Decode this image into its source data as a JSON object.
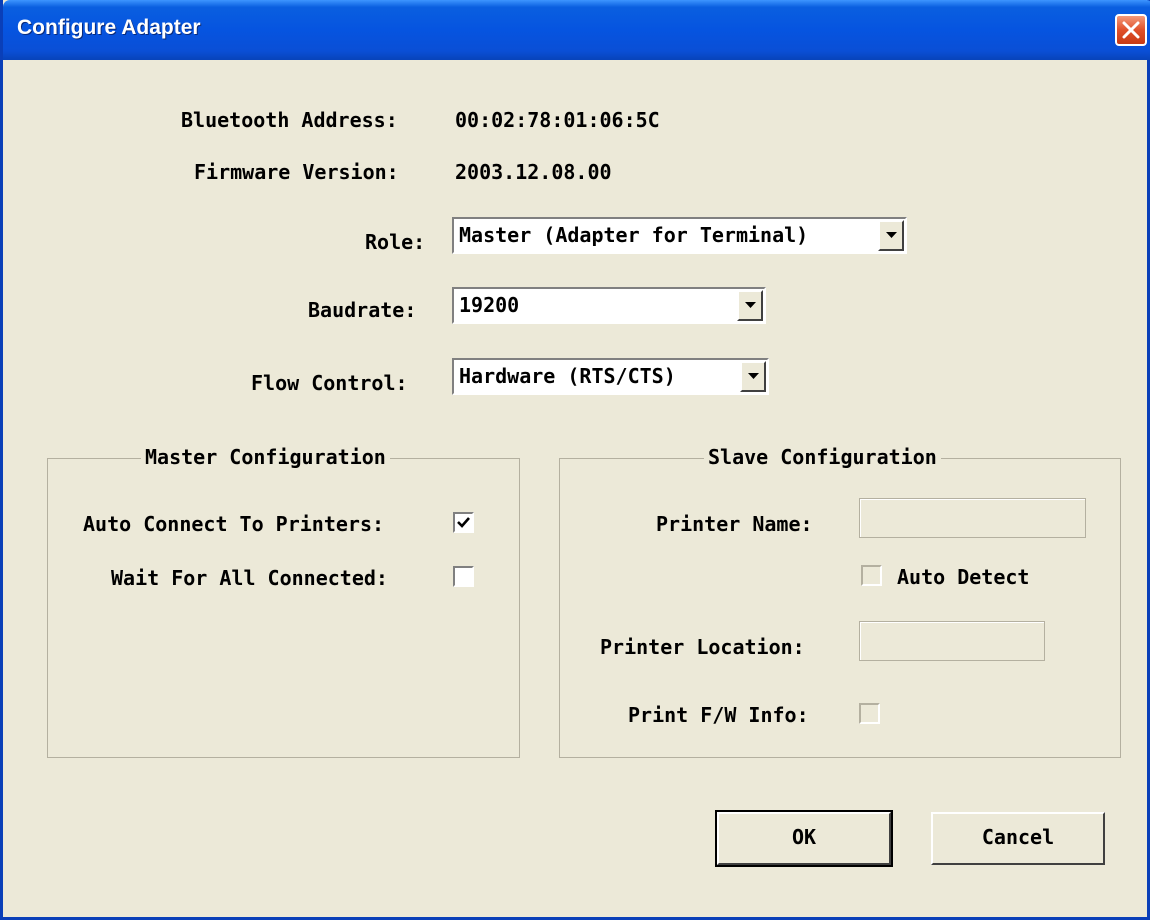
{
  "window": {
    "title": "Configure Adapter"
  },
  "info": {
    "bt_label": "Bluetooth Address:",
    "bt_value": "00:02:78:01:06:5C",
    "fw_label": "Firmware Version:",
    "fw_value": "2003.12.08.00"
  },
  "role": {
    "label": "Role:",
    "value": "Master (Adapter for Terminal)"
  },
  "baudrate": {
    "label": "Baudrate:",
    "value": "19200"
  },
  "flow": {
    "label": "Flow Control:",
    "value": "Hardware (RTS/CTS)"
  },
  "master": {
    "title": "Master Configuration",
    "auto_connect_label": "Auto Connect To Printers:",
    "auto_connect_checked": true,
    "wait_label": "Wait For All Connected:",
    "wait_checked": false
  },
  "slave": {
    "title": "Slave Configuration",
    "printer_name_label": "Printer Name:",
    "printer_name_value": "",
    "auto_detect_label": "Auto Detect",
    "auto_detect_checked": false,
    "printer_location_label": "Printer Location:",
    "printer_location_value": "",
    "print_fw_label": "Print F/W Info:",
    "print_fw_checked": false
  },
  "buttons": {
    "ok": "OK",
    "cancel": "Cancel"
  },
  "colors": {
    "titlebar": "#0654e0",
    "face": "#ece9d8",
    "close": "#e0502a"
  }
}
